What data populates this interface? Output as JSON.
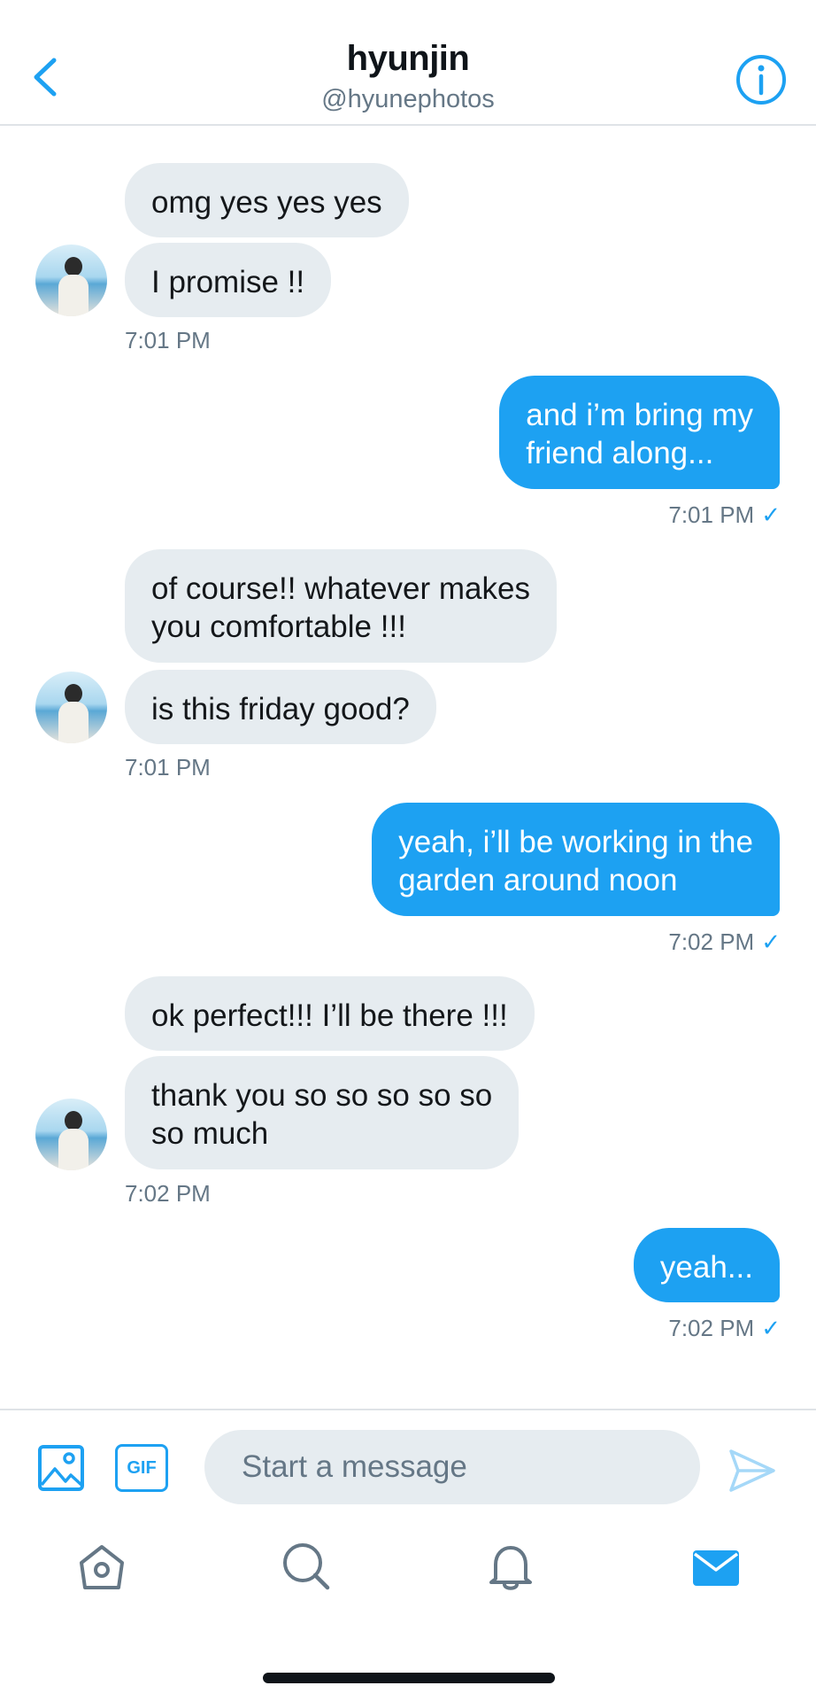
{
  "header": {
    "name": "hyunjin",
    "handle": "@hyunephotos"
  },
  "messages": [
    {
      "id": "m1",
      "from": "them",
      "text": "omg yes yes yes"
    },
    {
      "id": "m2",
      "from": "them",
      "text": "I promise !!"
    },
    {
      "id": "t1",
      "kind": "timestamp",
      "text": "7:01 PM"
    },
    {
      "id": "m3",
      "from": "me",
      "text": "and i’m bring my\nfriend along..."
    },
    {
      "id": "t2",
      "kind": "timestamp",
      "text": "7:01 PM",
      "read": "✓"
    },
    {
      "id": "m4",
      "from": "them",
      "text": "of course!! whatever makes\nyou comfortable !!!"
    },
    {
      "id": "m5",
      "from": "them",
      "text": "is this friday good?"
    },
    {
      "id": "t3",
      "kind": "timestamp",
      "text": "7:01 PM"
    },
    {
      "id": "m6",
      "from": "me",
      "text": "yeah, i’ll be working in the\ngarden around noon"
    },
    {
      "id": "t4",
      "kind": "timestamp",
      "text": "7:02 PM",
      "read": "✓"
    },
    {
      "id": "m7",
      "from": "them",
      "text": "ok perfect!!! I’ll be there !!!"
    },
    {
      "id": "m8",
      "from": "them",
      "text": "thank you so so so so so\nso much"
    },
    {
      "id": "t5",
      "kind": "timestamp",
      "text": "7:02 PM"
    },
    {
      "id": "m9",
      "from": "me",
      "text": "yeah..."
    },
    {
      "id": "t6",
      "kind": "timestamp",
      "text": "7:02 PM",
      "read": "✓"
    }
  ],
  "composer": {
    "placeholder": "Start a message",
    "gif_label": "GIF",
    "media_icon": "image-icon",
    "send_icon": "send-icon"
  },
  "tabbar": {
    "items": [
      {
        "name": "home",
        "icon": "home-icon"
      },
      {
        "name": "search",
        "icon": "search-icon"
      },
      {
        "name": "notifications",
        "icon": "bell-icon"
      },
      {
        "name": "messages",
        "icon": "mail-icon",
        "active": true
      }
    ]
  },
  "colors": {
    "accent": "#1da1f2",
    "incoming_bubble": "#e6ecf0",
    "secondary_text": "#657786",
    "divider": "#dfe3e7"
  }
}
